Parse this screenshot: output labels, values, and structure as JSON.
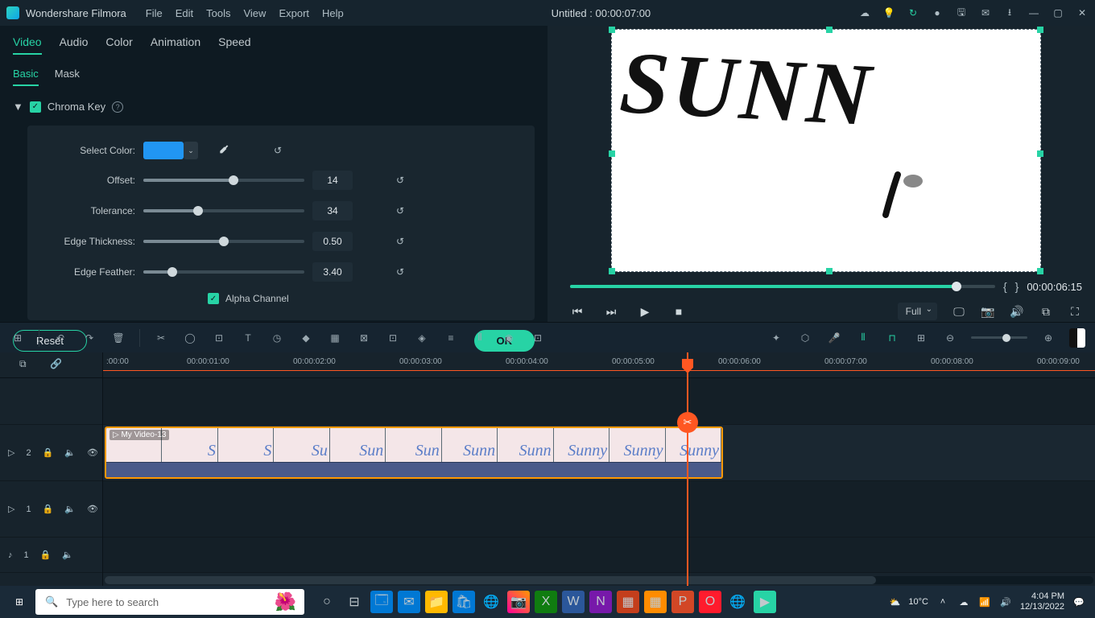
{
  "titlebar": {
    "app_name": "Wondershare Filmora",
    "menus": [
      "File",
      "Edit",
      "Tools",
      "View",
      "Export",
      "Help"
    ],
    "doc_title": "Untitled : 00:00:07:00"
  },
  "tabs1": {
    "items": [
      "Video",
      "Audio",
      "Color",
      "Animation",
      "Speed"
    ],
    "active": 0
  },
  "tabs2": {
    "items": [
      "Basic",
      "Mask"
    ],
    "active": 0
  },
  "chroma": {
    "title": "Chroma Key",
    "select_color_label": "Select Color:",
    "color": "#2196f3",
    "offset_label": "Offset:",
    "offset_val": "14",
    "tolerance_label": "Tolerance:",
    "tolerance_val": "34",
    "edge_thickness_label": "Edge Thickness:",
    "edge_thickness_val": "0.50",
    "edge_feather_label": "Edge Feather:",
    "edge_feather_val": "3.40",
    "alpha_label": "Alpha Channel"
  },
  "buttons": {
    "reset": "Reset",
    "ok": "OK"
  },
  "preview": {
    "text": "SUNN"
  },
  "playback": {
    "timecode": "00:00:06:15",
    "quality": "Full"
  },
  "ruler": {
    "ticks": [
      ":00:00",
      "00:00:01:00",
      "00:00:02:00",
      "00:00:03:00",
      "00:00:04:00",
      "00:00:05:00",
      "00:00:06:00",
      "00:00:07:00",
      "00:00:08:00",
      "00:00:09:00"
    ]
  },
  "tracks": {
    "v2": "2",
    "v1": "1",
    "a1": "1",
    "clip_title": "My Video-13"
  },
  "taskbar": {
    "search_placeholder": "Type here to search",
    "weather": "10°C",
    "time": "4:04 PM",
    "date": "12/13/2022"
  }
}
